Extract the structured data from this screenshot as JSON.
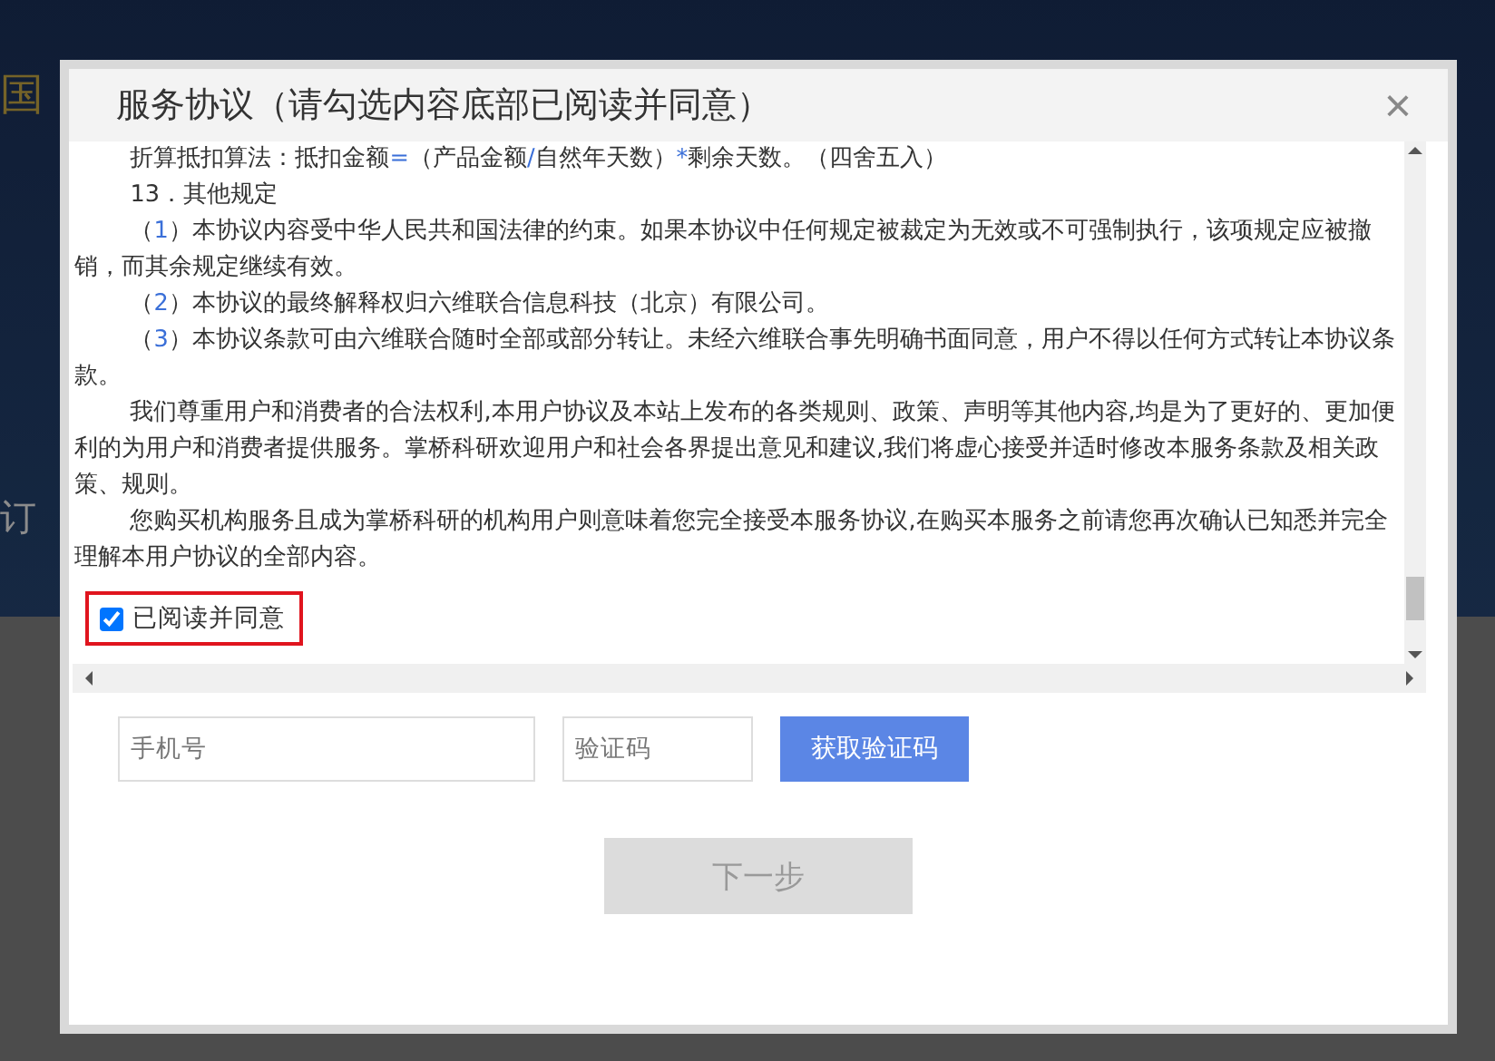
{
  "background": {
    "fragments": [
      "国",
      "订"
    ]
  },
  "dialog": {
    "title": "服务协议（请勾选内容底部已阅读并同意）",
    "close_icon": "×",
    "paragraphs": [
      [
        {
          "text": "折算抵扣算法：抵扣金额",
          "accent": false
        },
        {
          "text": "=",
          "accent": true
        },
        {
          "text": "（产品金额",
          "accent": false
        },
        {
          "text": "/",
          "accent": true
        },
        {
          "text": "自然年天数）",
          "accent": false
        },
        {
          "text": "*",
          "accent": true
        },
        {
          "text": "剩余天数。（四舍五入）",
          "accent": false
        }
      ],
      [
        {
          "text": "13．其他规定",
          "accent": false
        }
      ],
      [
        {
          "text": "（",
          "accent": false
        },
        {
          "text": "1",
          "accent": true
        },
        {
          "text": "）本协议内容受中华人民共和国法律的约束。如果本协议中任何规定被裁定为无效或不可强制执行，该项规定应被撤销，而其余规定继续有效。",
          "accent": false
        }
      ],
      [
        {
          "text": "（",
          "accent": false
        },
        {
          "text": "2",
          "accent": true
        },
        {
          "text": "）本协议的最终解释权归六维联合信息科技（北京）有限公司。",
          "accent": false
        }
      ],
      [
        {
          "text": "（",
          "accent": false
        },
        {
          "text": "3",
          "accent": true
        },
        {
          "text": "）本协议条款可由六维联合随时全部或部分转让。未经六维联合事先明确书面同意，用户不得以任何方式转让本协议条款。",
          "accent": false
        }
      ],
      [
        {
          "text": "我们尊重用户和消费者的合法权利,本用户协议及本站上发布的各类规则、政策、声明等其他内容,均是为了更好的、更加便利的为用户和消费者提供服务。掌桥科研欢迎用户和社会各界提出意见和建议,我们将虚心接受并适时修改本服务条款及相关政策、规则。",
          "accent": false
        }
      ],
      [
        {
          "text": "您购买机构服务且成为掌桥科研的机构用户则意味着您完全接受本服务协议,在购买本服务之前请您再次确认已知悉并完全理解本用户协议的全部内容。",
          "accent": false
        }
      ]
    ],
    "agree": {
      "label": "已阅读并同意",
      "checked": true
    },
    "phone": {
      "placeholder": "手机号"
    },
    "code": {
      "placeholder": "验证码"
    },
    "get_code_button": "获取验证码",
    "next_button": {
      "label": "下一步",
      "disabled": true
    }
  }
}
